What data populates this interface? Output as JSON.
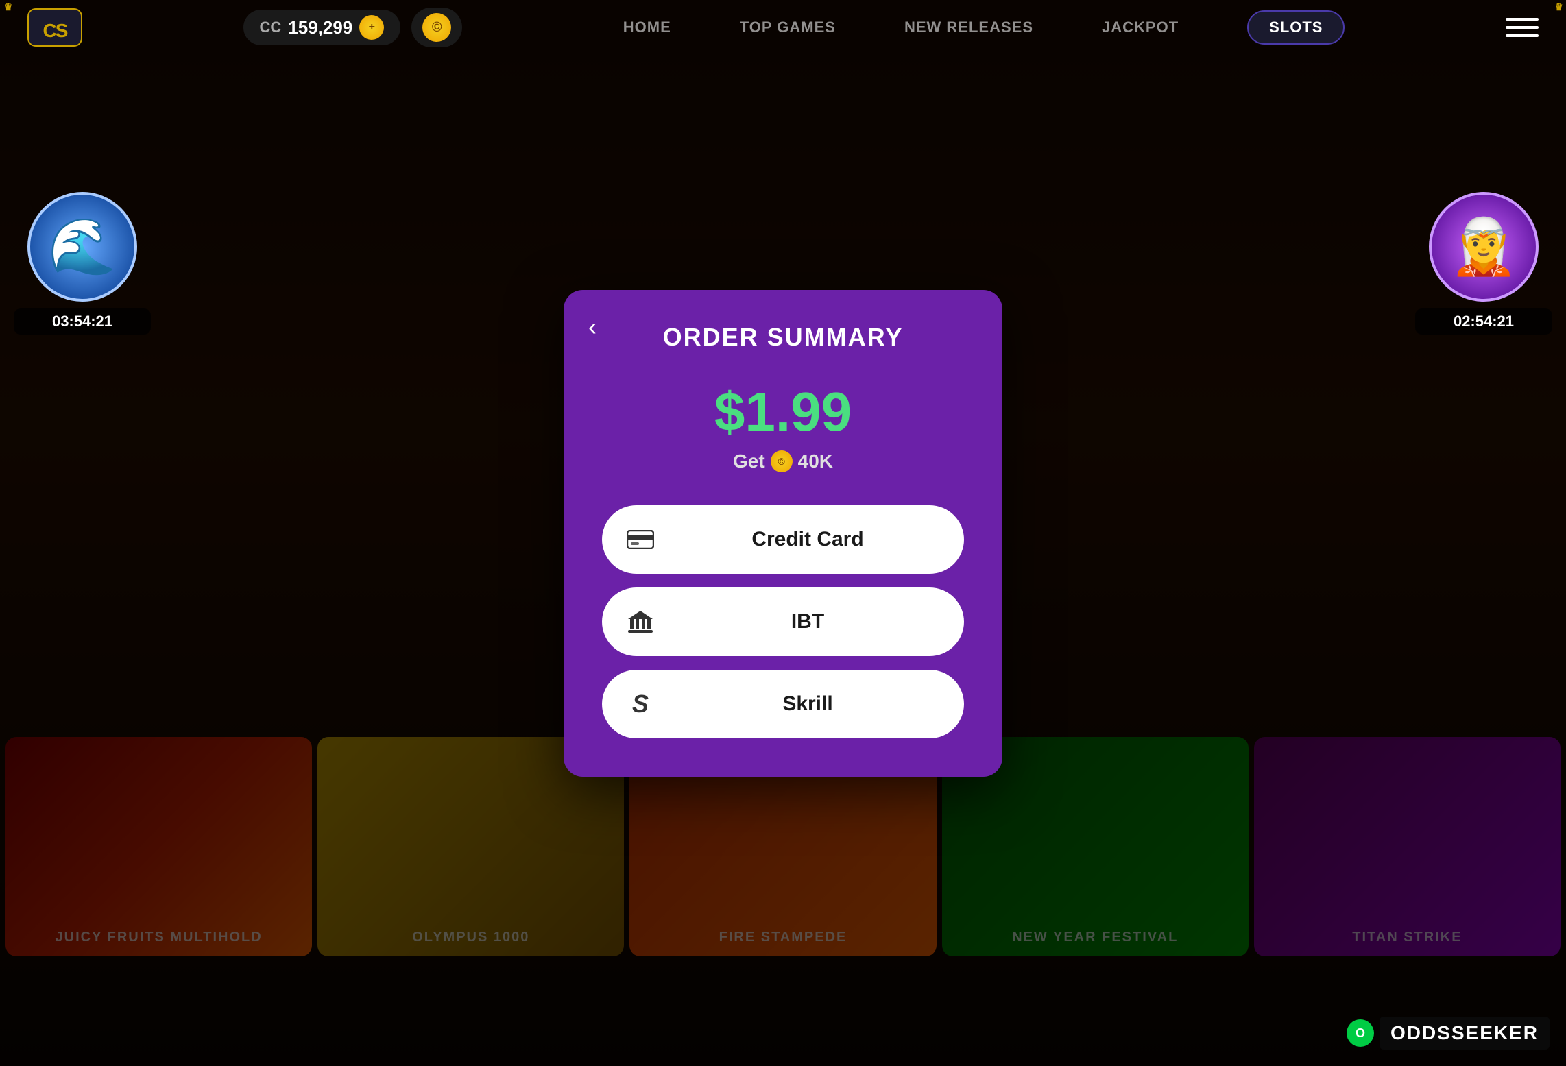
{
  "app": {
    "logo": "CS",
    "crown_icon": "♛"
  },
  "topbar": {
    "cc_label": "CC",
    "cc_amount": "159,299",
    "coin_symbol": "©",
    "menu_icon": "☰"
  },
  "nav": {
    "items": [
      {
        "label": "HOME",
        "active": false
      },
      {
        "label": "TOP GAMES",
        "active": false
      },
      {
        "label": "NEW RELEASES",
        "active": false
      },
      {
        "label": "JACKPOT",
        "active": false
      },
      {
        "label": "SLOTS",
        "active": true
      }
    ]
  },
  "side_chars": {
    "left_timer": "03:54:21",
    "right_timer": "02:54:21"
  },
  "modal": {
    "title": "ORDER SUMMARY",
    "back_label": "‹",
    "price": "$1.99",
    "get_label": "Get",
    "coin_symbol": "©",
    "coins_amount": "40K",
    "payment_options": [
      {
        "id": "credit-card",
        "label": "Credit Card",
        "icon": "credit-card-icon",
        "icon_char": "⊟"
      },
      {
        "id": "ibt",
        "label": "IBT",
        "icon": "bank-icon",
        "icon_char": "🏛"
      },
      {
        "id": "skrill",
        "label": "Skrill",
        "icon": "skrill-icon",
        "icon_char": "S"
      }
    ]
  },
  "background_games": [
    {
      "label": "Juicy Fruits Multihold",
      "color": "game-color-1"
    },
    {
      "label": "Olympus 1000",
      "color": "game-color-2"
    },
    {
      "label": "Fire Stampede",
      "color": "game-color-3"
    },
    {
      "label": "New Year Festival",
      "color": "game-color-4"
    },
    {
      "label": "Titan Strike",
      "color": "game-color-6"
    }
  ],
  "watermark": {
    "logo": "O",
    "text": "ODDSSEEKER"
  },
  "colors": {
    "modal_bg": "#6b21a8",
    "price_color": "#4ade80",
    "accent": "#c8a000"
  }
}
